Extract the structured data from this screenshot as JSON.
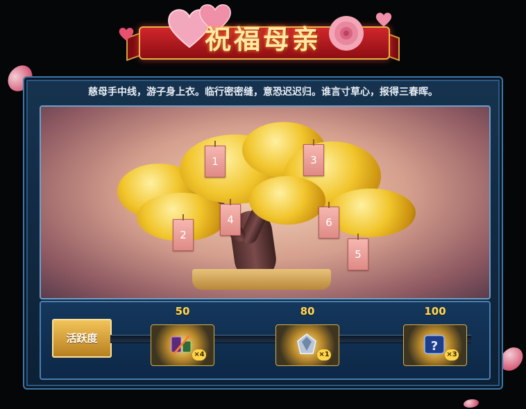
{
  "banner": {
    "title": "祝福母亲"
  },
  "poem": "慈母手中线，游子身上衣。临行密密缝，意恐迟迟归。谁言寸草心，报得三春晖。",
  "tree_tags": [
    "1",
    "2",
    "3",
    "4",
    "5",
    "6"
  ],
  "activity": {
    "label": "活跃度",
    "rewards": [
      {
        "points": "50",
        "count": "×4",
        "icon": "fireworks-pack-icon"
      },
      {
        "points": "80",
        "count": "×1",
        "icon": "crystal-gem-icon"
      },
      {
        "points": "100",
        "count": "×3",
        "icon": "mystery-box-icon"
      }
    ]
  },
  "colors": {
    "accent_gold": "#ffd75a",
    "frame_blue": "#3e77a6",
    "ribbon_red": "#d0262b",
    "tag_pink": "#f6b7b0"
  }
}
